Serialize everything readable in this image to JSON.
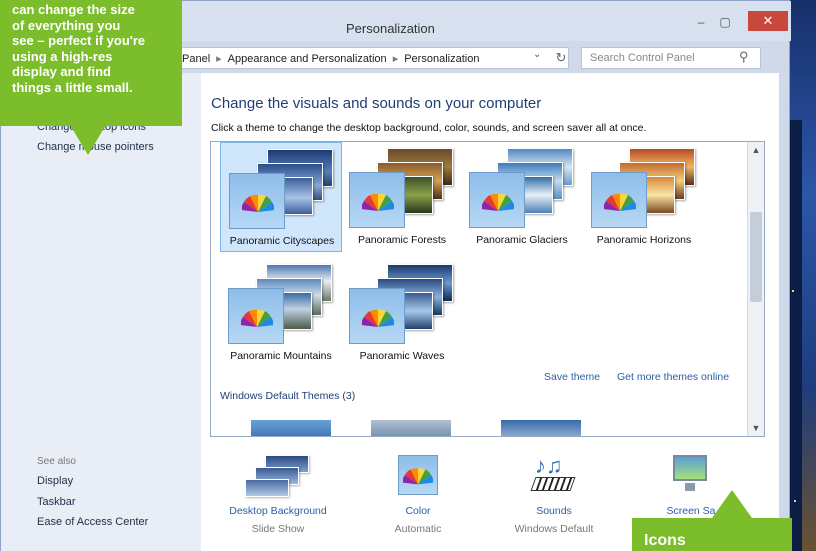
{
  "window": {
    "title": "Personalization"
  },
  "address": {
    "segments": [
      "Panel",
      "Appearance and Personalization",
      "Personalization"
    ],
    "search_placeholder": "Search Control Panel"
  },
  "left_pane": {
    "links": [
      "Change desktop icons",
      "Change mouse pointers"
    ],
    "see_also_label": "See also",
    "see_also_links": [
      "Display",
      "Taskbar",
      "Ease of Access Center"
    ]
  },
  "main": {
    "heading": "Change the visuals and sounds on your computer",
    "subheading": "Click a theme to change the desktop background, color, sounds, and screen saver all at once.",
    "themes": [
      {
        "label": "Panoramic Cityscapes",
        "selected": true
      },
      {
        "label": "Panoramic Forests"
      },
      {
        "label": "Panoramic Glaciers"
      },
      {
        "label": "Panoramic Horizons"
      },
      {
        "label": "Panoramic Mountains"
      },
      {
        "label": "Panoramic Waves"
      }
    ],
    "save_theme": "Save theme",
    "more_themes": "Get more themes online",
    "default_group": "Windows Default Themes (3)"
  },
  "bottom": [
    {
      "title": "Desktop Background",
      "sub": "Slide Show",
      "icon": "desktop-background-icon"
    },
    {
      "title": "Color",
      "sub": "Automatic",
      "icon": "color-icon"
    },
    {
      "title": "Sounds",
      "sub": "Windows Default",
      "icon": "sounds-icon"
    },
    {
      "title": "Screen Sa",
      "sub": "",
      "icon": "screen-saver-icon"
    }
  ],
  "callouts": {
    "top_lines": [
      "can change the size",
      "of everything you",
      "see – perfect if you're",
      "using a high-res",
      "display and find",
      "things a little small."
    ],
    "bottom": "Icons"
  },
  "colors": {
    "accent_green": "#7cbd2c",
    "link_blue": "#2b5fa5",
    "heading_blue": "#1e3f75"
  }
}
